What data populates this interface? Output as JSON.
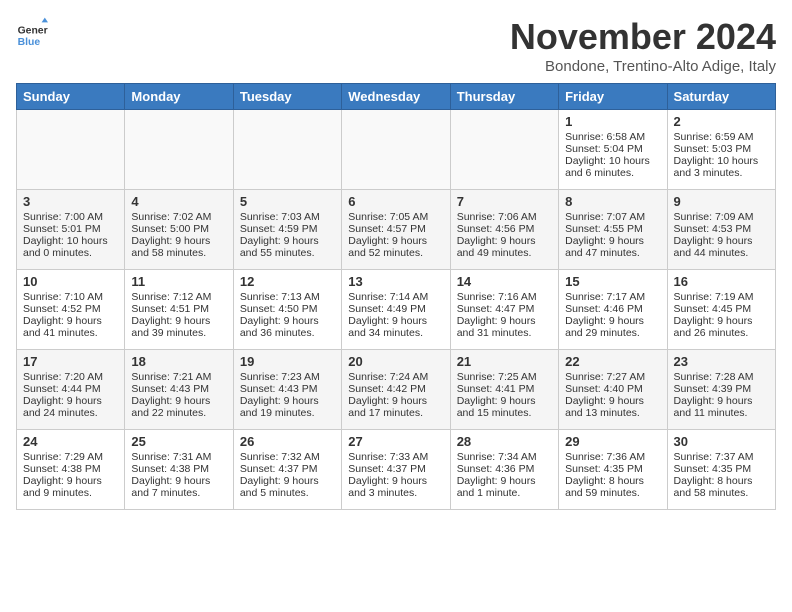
{
  "header": {
    "logo_line1": "General",
    "logo_line2": "Blue",
    "month_title": "November 2024",
    "location": "Bondone, Trentino-Alto Adige, Italy"
  },
  "days_of_week": [
    "Sunday",
    "Monday",
    "Tuesday",
    "Wednesday",
    "Thursday",
    "Friday",
    "Saturday"
  ],
  "weeks": [
    [
      {
        "day": "",
        "info": ""
      },
      {
        "day": "",
        "info": ""
      },
      {
        "day": "",
        "info": ""
      },
      {
        "day": "",
        "info": ""
      },
      {
        "day": "",
        "info": ""
      },
      {
        "day": "1",
        "info": "Sunrise: 6:58 AM\nSunset: 5:04 PM\nDaylight: 10 hours and 6 minutes."
      },
      {
        "day": "2",
        "info": "Sunrise: 6:59 AM\nSunset: 5:03 PM\nDaylight: 10 hours and 3 minutes."
      }
    ],
    [
      {
        "day": "3",
        "info": "Sunrise: 7:00 AM\nSunset: 5:01 PM\nDaylight: 10 hours and 0 minutes."
      },
      {
        "day": "4",
        "info": "Sunrise: 7:02 AM\nSunset: 5:00 PM\nDaylight: 9 hours and 58 minutes."
      },
      {
        "day": "5",
        "info": "Sunrise: 7:03 AM\nSunset: 4:59 PM\nDaylight: 9 hours and 55 minutes."
      },
      {
        "day": "6",
        "info": "Sunrise: 7:05 AM\nSunset: 4:57 PM\nDaylight: 9 hours and 52 minutes."
      },
      {
        "day": "7",
        "info": "Sunrise: 7:06 AM\nSunset: 4:56 PM\nDaylight: 9 hours and 49 minutes."
      },
      {
        "day": "8",
        "info": "Sunrise: 7:07 AM\nSunset: 4:55 PM\nDaylight: 9 hours and 47 minutes."
      },
      {
        "day": "9",
        "info": "Sunrise: 7:09 AM\nSunset: 4:53 PM\nDaylight: 9 hours and 44 minutes."
      }
    ],
    [
      {
        "day": "10",
        "info": "Sunrise: 7:10 AM\nSunset: 4:52 PM\nDaylight: 9 hours and 41 minutes."
      },
      {
        "day": "11",
        "info": "Sunrise: 7:12 AM\nSunset: 4:51 PM\nDaylight: 9 hours and 39 minutes."
      },
      {
        "day": "12",
        "info": "Sunrise: 7:13 AM\nSunset: 4:50 PM\nDaylight: 9 hours and 36 minutes."
      },
      {
        "day": "13",
        "info": "Sunrise: 7:14 AM\nSunset: 4:49 PM\nDaylight: 9 hours and 34 minutes."
      },
      {
        "day": "14",
        "info": "Sunrise: 7:16 AM\nSunset: 4:47 PM\nDaylight: 9 hours and 31 minutes."
      },
      {
        "day": "15",
        "info": "Sunrise: 7:17 AM\nSunset: 4:46 PM\nDaylight: 9 hours and 29 minutes."
      },
      {
        "day": "16",
        "info": "Sunrise: 7:19 AM\nSunset: 4:45 PM\nDaylight: 9 hours and 26 minutes."
      }
    ],
    [
      {
        "day": "17",
        "info": "Sunrise: 7:20 AM\nSunset: 4:44 PM\nDaylight: 9 hours and 24 minutes."
      },
      {
        "day": "18",
        "info": "Sunrise: 7:21 AM\nSunset: 4:43 PM\nDaylight: 9 hours and 22 minutes."
      },
      {
        "day": "19",
        "info": "Sunrise: 7:23 AM\nSunset: 4:43 PM\nDaylight: 9 hours and 19 minutes."
      },
      {
        "day": "20",
        "info": "Sunrise: 7:24 AM\nSunset: 4:42 PM\nDaylight: 9 hours and 17 minutes."
      },
      {
        "day": "21",
        "info": "Sunrise: 7:25 AM\nSunset: 4:41 PM\nDaylight: 9 hours and 15 minutes."
      },
      {
        "day": "22",
        "info": "Sunrise: 7:27 AM\nSunset: 4:40 PM\nDaylight: 9 hours and 13 minutes."
      },
      {
        "day": "23",
        "info": "Sunrise: 7:28 AM\nSunset: 4:39 PM\nDaylight: 9 hours and 11 minutes."
      }
    ],
    [
      {
        "day": "24",
        "info": "Sunrise: 7:29 AM\nSunset: 4:38 PM\nDaylight: 9 hours and 9 minutes."
      },
      {
        "day": "25",
        "info": "Sunrise: 7:31 AM\nSunset: 4:38 PM\nDaylight: 9 hours and 7 minutes."
      },
      {
        "day": "26",
        "info": "Sunrise: 7:32 AM\nSunset: 4:37 PM\nDaylight: 9 hours and 5 minutes."
      },
      {
        "day": "27",
        "info": "Sunrise: 7:33 AM\nSunset: 4:37 PM\nDaylight: 9 hours and 3 minutes."
      },
      {
        "day": "28",
        "info": "Sunrise: 7:34 AM\nSunset: 4:36 PM\nDaylight: 9 hours and 1 minute."
      },
      {
        "day": "29",
        "info": "Sunrise: 7:36 AM\nSunset: 4:35 PM\nDaylight: 8 hours and 59 minutes."
      },
      {
        "day": "30",
        "info": "Sunrise: 7:37 AM\nSunset: 4:35 PM\nDaylight: 8 hours and 58 minutes."
      }
    ]
  ]
}
